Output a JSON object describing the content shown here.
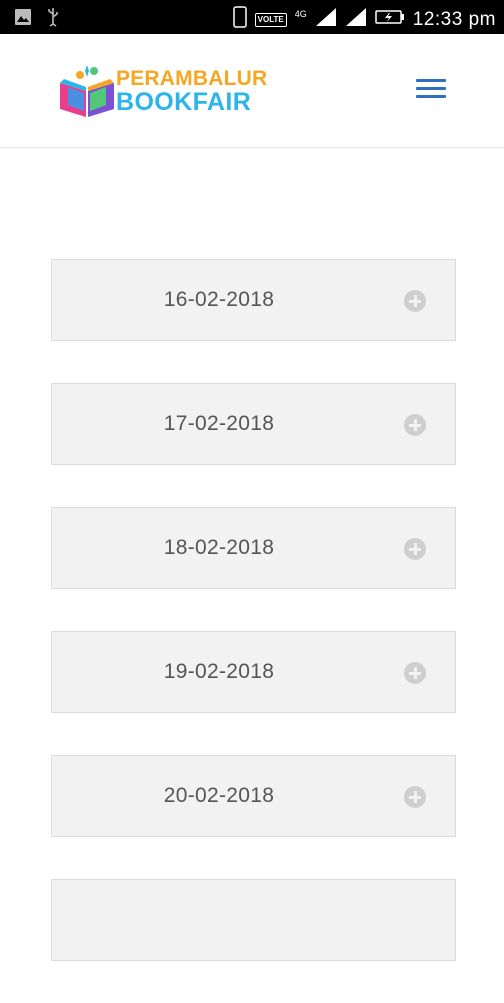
{
  "status_bar": {
    "time": "12:33 pm",
    "volte_label": "VOLTE",
    "network_label": "4G",
    "icons": [
      "image-icon",
      "usb-icon",
      "phone-icon",
      "signal-icon",
      "signal-icon",
      "battery-charging-icon"
    ]
  },
  "header": {
    "logo_line1": "PERAMBALUR",
    "logo_line2": "BOOKFAIR",
    "menu_icon": "hamburger-menu-icon",
    "accent_color": "#2f6fbf"
  },
  "accordion": {
    "items": [
      {
        "label": "16-02-2018",
        "icon": "plus-circle-icon"
      },
      {
        "label": "17-02-2018",
        "icon": "plus-circle-icon"
      },
      {
        "label": "18-02-2018",
        "icon": "plus-circle-icon"
      },
      {
        "label": "19-02-2018",
        "icon": "plus-circle-icon"
      },
      {
        "label": "20-02-2018",
        "icon": "plus-circle-icon"
      },
      {
        "label": "",
        "icon": ""
      }
    ]
  }
}
